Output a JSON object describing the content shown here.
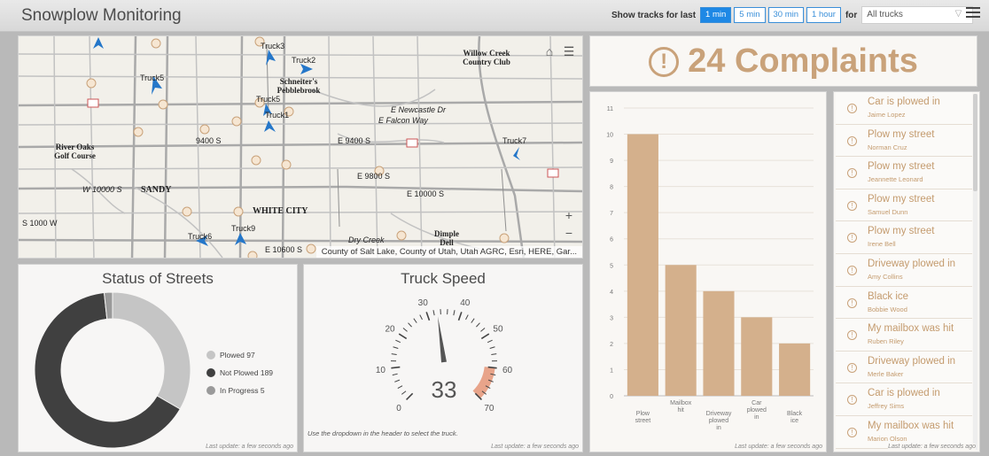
{
  "header": {
    "title": "Snowplow Monitoring",
    "show_tracks_label": "Show tracks for last",
    "time_options": [
      "1 min",
      "5 min",
      "30 min",
      "1 hour"
    ],
    "selected_time": "1 min",
    "for_label": "for",
    "truck_select_value": "All trucks"
  },
  "map": {
    "attribution": "County of Salt Lake, County of Utah, Utah AGRC, Esri, HERE, Gar...",
    "zoom_in": "+",
    "zoom_out": "−",
    "trucks": [
      "Truck1",
      "Truck2",
      "Truck3",
      "Truck5",
      "Truck5",
      "Truck6",
      "Truck7",
      "Truck9"
    ],
    "places": [
      "Willow Creek Country Club",
      "Schneiter's Pebblebrook",
      "River Oaks Golf Course",
      "SANDY",
      "WHITE CITY",
      "Dimple Dell",
      "E Falcon Way",
      "E Newcastle Dr",
      "E 9400 S",
      "E 9800 S",
      "E 10000 S",
      "E 10600 S",
      "W 10000 S",
      "Dry Creek",
      "9400 S",
      "S 1000 W"
    ],
    "shields": [
      "209",
      "209",
      "209"
    ]
  },
  "status": {
    "title": "Status of Streets",
    "update": "Last update: a few seconds ago",
    "legend": [
      {
        "label": "Plowed",
        "value": "97",
        "color": "#c5c5c5"
      },
      {
        "label": "Not Plowed",
        "value": "189",
        "color": "#404040"
      },
      {
        "label": "In Progress",
        "value": "5",
        "color": "#9a9a9a"
      }
    ]
  },
  "speed": {
    "title": "Truck Speed",
    "value": "33",
    "min": 0,
    "max": 70,
    "warning_start": 60,
    "ticks": [
      "0",
      "10",
      "20",
      "30",
      "40",
      "50",
      "60",
      "70"
    ],
    "note": "Use the dropdown in the header to select the truck.",
    "update": "Last update: a few seconds ago"
  },
  "complaints": {
    "count": "24",
    "label": "Complaints"
  },
  "chart_data": {
    "type": "bar",
    "categories": [
      "Plow street",
      "Mailbox hit",
      "Driveway plowed in",
      "Car plowed in",
      "Black ice"
    ],
    "category_lines": [
      [
        "Plow",
        "street"
      ],
      [
        "Mailbox",
        "hit"
      ],
      [
        "Driveway",
        "plowed",
        "in"
      ],
      [
        "Car",
        "plowed",
        "in"
      ],
      [
        "Black",
        "ice"
      ]
    ],
    "values": [
      10,
      5,
      4,
      3,
      2
    ],
    "ylim": [
      0,
      11
    ],
    "yticks": [
      "0",
      "1",
      "2",
      "3",
      "4",
      "5",
      "6",
      "7",
      "8",
      "9",
      "10",
      "11"
    ],
    "bar_color": "#d4b08c",
    "update": "Last update: a few seconds ago"
  },
  "complaint_list": {
    "items": [
      {
        "title": "Car is plowed in",
        "name": "Jaime Lopez"
      },
      {
        "title": "Plow my street",
        "name": "Norman Cruz"
      },
      {
        "title": "Plow my street",
        "name": "Jeannette Leonard"
      },
      {
        "title": "Plow my street",
        "name": "Samuel Dunn"
      },
      {
        "title": "Plow my street",
        "name": "Irene Bell"
      },
      {
        "title": "Driveway plowed in",
        "name": "Amy Collins"
      },
      {
        "title": "Black ice",
        "name": "Bobbie Wood"
      },
      {
        "title": "My mailbox was hit",
        "name": "Ruben Riley"
      },
      {
        "title": "Driveway plowed in",
        "name": "Merle Baker"
      },
      {
        "title": "Car is plowed in",
        "name": "Jeffrey Sims"
      },
      {
        "title": "My mailbox was hit",
        "name": "Marion Olson"
      }
    ],
    "update": "Last update: a few seconds ago"
  },
  "colors": {
    "accent": "#c9a27a",
    "header_button": "#1e88e5"
  }
}
